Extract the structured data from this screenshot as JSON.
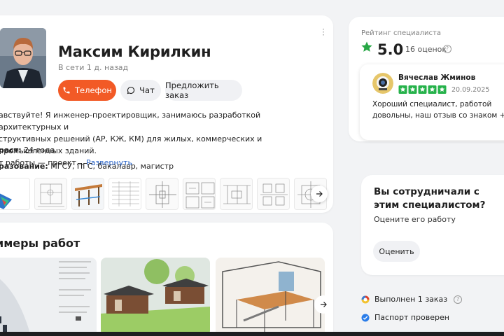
{
  "profile": {
    "name": "Максим Кирилкин",
    "status": "В сети 1 д. назад",
    "buttons": {
      "phone": "Телефон",
      "chat": "Чат",
      "offer": "Предложить заказ"
    },
    "about_text": "авствуйте! Я инженер-проектировщик, занимаюсь разработкой архитектурных и\nструктивных решений (АР, КЖ, КМ) для жилых, коммерческих и промышленных зданий.\nт работы — проект...",
    "about_more": "Развернуть",
    "age_label": "раст:",
    "age_value": "24 года",
    "edu_label": "разование:",
    "edu_value": "МГСУ, ПГС, бакалавр, магистр"
  },
  "works": {
    "title": "имеры работ"
  },
  "rating": {
    "label": "Рейтинг специалиста",
    "value": "5.0",
    "count": "16 оценок",
    "accent_color": "#27a745"
  },
  "review": {
    "name": "Вячеслав Жминов",
    "stars": 5,
    "date": "20.09.2025",
    "text": "Хороший специалист, работой довольны, наш отзыв со знаком +"
  },
  "cooperate": {
    "title": "Вы сотрудничали с этим специалистом?",
    "subtitle": "Оцените его работу",
    "button": "Оценить"
  },
  "badges": {
    "orders": "Выполнен 1 заказ",
    "passport": "Паспорт проверен"
  },
  "colors": {
    "primary": "#f25a26",
    "link": "#2a64c7",
    "star": "#27a745",
    "review_star": "#26b24b"
  }
}
